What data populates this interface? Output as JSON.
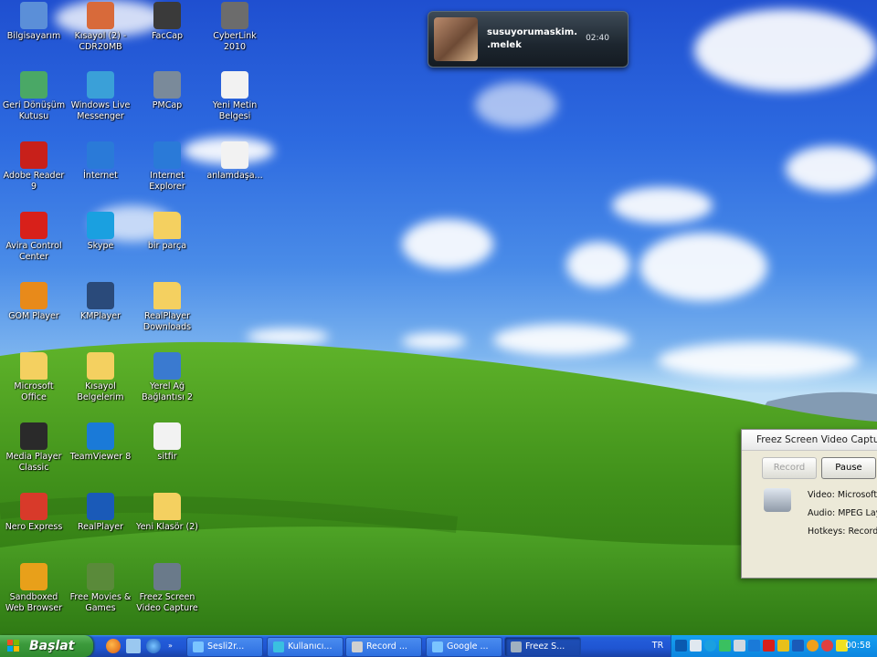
{
  "desktop": {
    "icons": [
      {
        "label": "Bilgisayarım",
        "icon": "computer-icon",
        "color": "#5b8fd8"
      },
      {
        "label": "Kısayol (2) - CDR20MB",
        "icon": "shortcut-icon",
        "color": "#d86a3a"
      },
      {
        "label": "FacCap",
        "icon": "webcam-icon",
        "color": "#3a3a3a"
      },
      {
        "label": "CyberLink 2010",
        "icon": "cyberlink-icon",
        "color": "#6c6c6c"
      },
      {
        "label": "Geri Dönüşüm Kutusu",
        "icon": "recycle-bin-icon",
        "color": "#4aa866"
      },
      {
        "label": "Windows Live Messenger",
        "icon": "messenger-icon",
        "color": "#3aa0d8"
      },
      {
        "label": "PMCap",
        "icon": "pmcap-icon",
        "color": "#7a8a9a"
      },
      {
        "label": "Yeni Metin Belgesi",
        "icon": "text-document-icon",
        "color": "#f2f2f2"
      },
      {
        "label": "Adobe Reader 9",
        "icon": "adobe-reader-icon",
        "color": "#c8201a"
      },
      {
        "label": "İnternet",
        "icon": "internet-explorer-icon",
        "color": "#2a7ad8"
      },
      {
        "label": "Internet Explorer",
        "icon": "internet-explorer-icon",
        "color": "#2a7ad8"
      },
      {
        "label": "anlamdaşa...",
        "icon": "text-document-icon",
        "color": "#f2f2f2"
      },
      {
        "label": "Avira Control Center",
        "icon": "avira-icon",
        "color": "#d8201a"
      },
      {
        "label": "Skype",
        "icon": "skype-icon",
        "color": "#1aa0e0"
      },
      {
        "label": "bir parça",
        "icon": "folder-icon",
        "color": "#f4d060"
      },
      {
        "label": "GOM Player",
        "icon": "gom-player-icon",
        "color": "#e88a1a"
      },
      {
        "label": "KMPlayer",
        "icon": "kmplayer-icon",
        "color": "#2a4a7a"
      },
      {
        "label": "RealPlayer Downloads",
        "icon": "folder-icon",
        "color": "#f4d060"
      },
      {
        "label": "Microsoft Office",
        "icon": "folder-icon",
        "color": "#f4d060"
      },
      {
        "label": "Kısayol Belgelerim",
        "icon": "my-documents-icon",
        "color": "#f4d060"
      },
      {
        "label": "Yerel Ağ Bağlantısı 2",
        "icon": "network-icon",
        "color": "#3a7ad0"
      },
      {
        "label": "Media Player Classic",
        "icon": "media-player-icon",
        "color": "#2a2a2a"
      },
      {
        "label": "TeamViewer 8",
        "icon": "teamviewer-icon",
        "color": "#1a7ad8"
      },
      {
        "label": "sitfir",
        "icon": "text-document-icon",
        "color": "#f2f2f2"
      },
      {
        "label": "Nero Express",
        "icon": "nero-icon",
        "color": "#d83a2a"
      },
      {
        "label": "RealPlayer",
        "icon": "realplayer-icon",
        "color": "#1a5ab8"
      },
      {
        "label": "Yeni Klasör (2)",
        "icon": "folder-icon",
        "color": "#f4d060"
      },
      {
        "label": "Sandboxed Web Browser",
        "icon": "sandbox-icon",
        "color": "#e8a01a"
      },
      {
        "label": "Free Movies & Games",
        "icon": "movies-games-icon",
        "color": "#5a8a3a"
      },
      {
        "label": "Freez Screen Video Capture",
        "icon": "video-capture-icon",
        "color": "#6a7a8a"
      }
    ]
  },
  "notification": {
    "name": "susuyorumaskim. .melek",
    "time": "02:40"
  },
  "freez_window": {
    "title": "Freez Screen Video Capture",
    "record_label": "Record",
    "pause_label": "Pause",
    "video_line": "Video: Microsoft V",
    "audio_line": "Audio: MPEG Lay",
    "hotkeys_line": "Hotkeys: Record"
  },
  "taskbar": {
    "start_label": "Başlat",
    "tasks": [
      {
        "label": "Sesli2r...",
        "icon": "internet-explorer-icon"
      },
      {
        "label": "Kullanıcı...",
        "icon": "globe-icon"
      },
      {
        "label": "Record ...",
        "icon": "record-icon"
      },
      {
        "label": "Google ...",
        "icon": "internet-explorer-icon"
      },
      {
        "label": "Freez S...",
        "icon": "video-capture-icon"
      }
    ],
    "language": "TR",
    "clock": "00:58"
  }
}
